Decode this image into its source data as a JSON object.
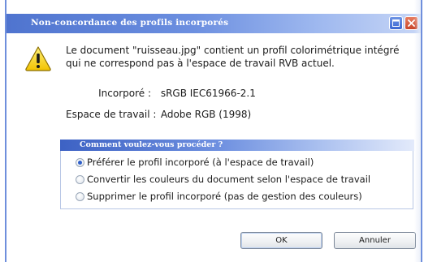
{
  "dialog": {
    "title": "Non-concordance des profils incorporés",
    "message": "Le document \"ruisseau.jpg\" contient un profil colorimétrique intégré\nqui ne correspond pas à l'espace de travail RVB actuel.",
    "embedded_label": "Incorporé :",
    "embedded_value": "sRGB IEC61966-2.1",
    "workspace_label": "Espace de travail :",
    "workspace_value": "Adobe RGB (1998)",
    "group_title": "Comment voulez-vous procéder ?",
    "options": [
      {
        "label": "Préférer le profil incorporé (à l'espace de travail)",
        "checked": true
      },
      {
        "label": "Convertir les couleurs du document selon l'espace de travail",
        "checked": false
      },
      {
        "label": "Supprimer le profil incorporé (pas de gestion des couleurs)",
        "checked": false
      }
    ],
    "ok_label": "OK",
    "cancel_label": "Annuler"
  },
  "icons": {
    "warning": "warning-icon",
    "maximize": "maximize-icon",
    "close": "close-icon"
  },
  "colors": {
    "titlebar_start": "#4f74cf",
    "titlebar_end": "#c7d6f6",
    "close_button": "#c8452a",
    "warning_yellow": "#f4d21f"
  }
}
